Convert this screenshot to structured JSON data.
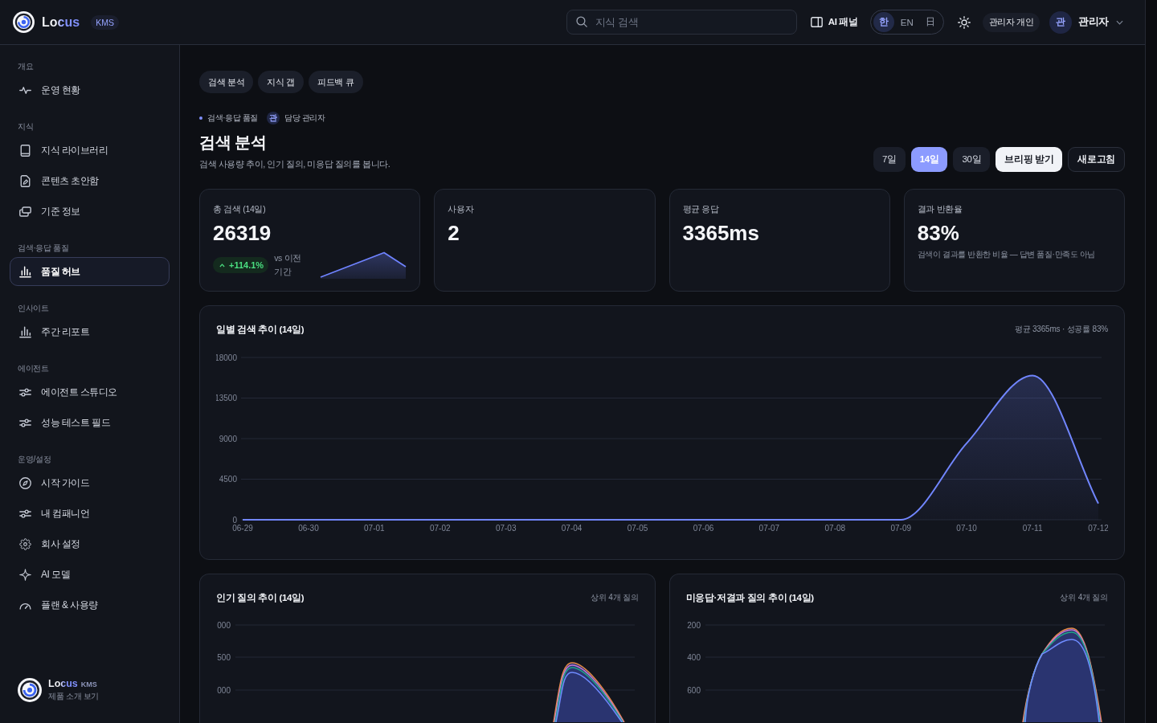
{
  "topbar": {
    "brand": {
      "name": "Locus",
      "badge": "KMS"
    },
    "search": {
      "placeholder": "지식 검색"
    },
    "ai_panel": {
      "label": "AI 패널"
    },
    "languages": [
      {
        "label": "한",
        "selected": true
      },
      {
        "label": "EN",
        "selected": false
      },
      {
        "label": "日",
        "selected": false
      }
    ],
    "workspace": "관리자 개인",
    "user": {
      "avatar": "관",
      "name": "관리자"
    }
  },
  "sidebar": {
    "sections": [
      {
        "title": "개요",
        "items": [
          {
            "label": "운영 현황",
            "selected": false
          }
        ]
      },
      {
        "title": "지식",
        "items": [
          {
            "label": "지식 라이브러리",
            "selected": false
          },
          {
            "label": "콘텐츠 초안함",
            "selected": false
          },
          {
            "label": "기준 정보",
            "selected": false
          }
        ]
      },
      {
        "title": "검색·응답 품질",
        "items": [
          {
            "label": "품질 허브",
            "selected": true
          }
        ]
      },
      {
        "title": "인사이트",
        "items": [
          {
            "label": "주간 리포트",
            "selected": false
          }
        ]
      },
      {
        "title": "에이전트",
        "items": [
          {
            "label": "에이전트 스튜디오",
            "selected": false
          },
          {
            "label": "성능 테스트 필드",
            "selected": false
          }
        ]
      },
      {
        "title": "운영/설정",
        "items": [
          {
            "label": "시작 가이드",
            "selected": false
          },
          {
            "label": "내 컴패니언",
            "selected": false
          },
          {
            "label": "회사 설정",
            "selected": false
          },
          {
            "label": "AI 모델",
            "selected": false
          },
          {
            "label": "플랜 & 사용량",
            "selected": false
          }
        ]
      }
    ],
    "footer": {
      "name": "Locus",
      "badge": "KMS",
      "link": "제품 소개 보기"
    }
  },
  "tabs": [
    {
      "label": "검색 분석"
    },
    {
      "label": "지식 갭"
    },
    {
      "label": "피드백 큐"
    }
  ],
  "header": {
    "breadcrumb": {
      "section": "검색·응답 품질",
      "owner_avatar": "관",
      "owner": "담당 관리자"
    },
    "title": "검색 분석",
    "subtitle": "검색 사용량 추이, 인기 질의, 미응답 질의를 봅니다.",
    "periods": [
      {
        "label": "7일",
        "selected": false
      },
      {
        "label": "14일",
        "selected": true
      },
      {
        "label": "30일",
        "selected": false
      }
    ],
    "actions": [
      {
        "label": "브리핑 받기",
        "kind": "primary"
      },
      {
        "label": "새로고침",
        "kind": "secondary"
      }
    ]
  },
  "kpis": [
    {
      "label": "총 검색 (14일)",
      "value": "26319",
      "change": {
        "positive": true,
        "value": "+114.1%",
        "note": "vs 이전 기간"
      }
    },
    {
      "label": "사용자",
      "value": "2"
    },
    {
      "label": "평균 응답",
      "value": "3365ms"
    },
    {
      "label": "결과 반환율",
      "value": "83%",
      "caption": "검색이 결과를 반환한 비율 — 답변 품질·만족도 아님"
    }
  ],
  "daily_chart": {
    "title": "일별 검색 추이 (14일)",
    "summary": "평균 3365ms · 성공률 83%",
    "chart_data": {
      "type": "area",
      "categories": [
        "06-29",
        "06-30",
        "07-01",
        "07-02",
        "07-03",
        "07-04",
        "07-05",
        "07-06",
        "07-07",
        "07-08",
        "07-09",
        "07-10",
        "07-11",
        "07-12"
      ],
      "values": [
        0,
        0,
        0,
        0,
        0,
        0,
        0,
        0,
        0,
        0,
        0,
        8500,
        16000,
        1800
      ],
      "ylim": [
        0,
        18000
      ],
      "yticks": [
        0,
        4500,
        9000,
        13500,
        18000
      ],
      "grid": true
    }
  },
  "query_charts": [
    {
      "title": "인기 질의 추이 (14일)",
      "note": "상위 4개 질의",
      "y_tick_labels": [
        "000",
        "500",
        "000"
      ]
    },
    {
      "title": "미응답·저결과 질의 추이 (14일)",
      "note": "상위 4개 질의",
      "y_tick_labels": [
        "200",
        "400",
        "600"
      ]
    }
  ]
}
